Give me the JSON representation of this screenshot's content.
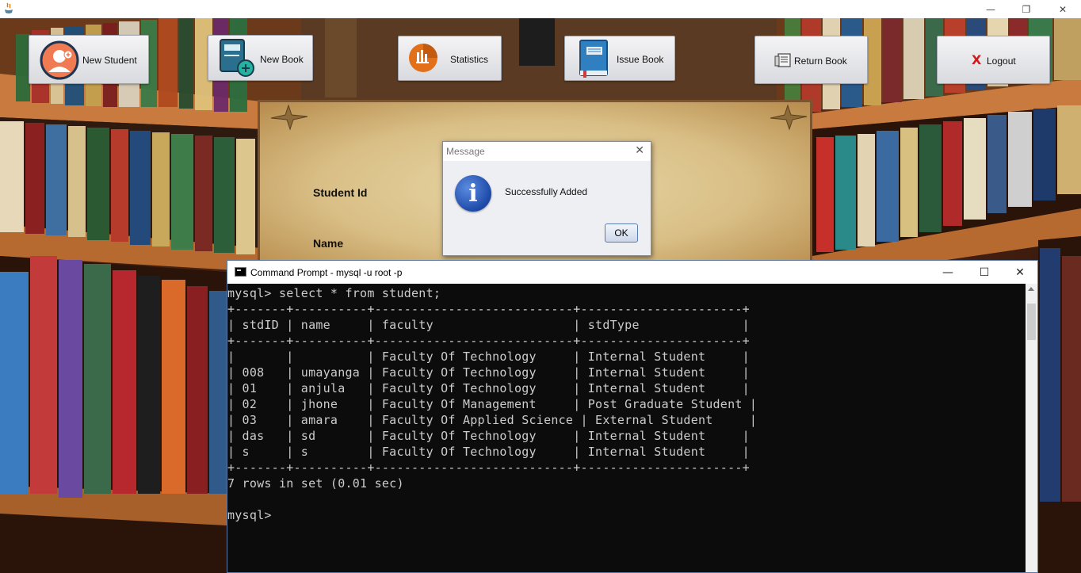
{
  "window": {
    "minimize_glyph": "—",
    "restore_glyph": "❐",
    "close_glyph": "✕"
  },
  "toolbar": {
    "new_student": "New Student",
    "new_book": "New Book",
    "statistics": "Statistics",
    "issue_book": "Issue Book",
    "return_book": "Return Book",
    "logout": "Logout",
    "logout_glyph": "X"
  },
  "form": {
    "student_id_label": "Student Id",
    "name_label": "Name"
  },
  "dialog": {
    "title": "Message",
    "close_glyph": "✕",
    "icon_glyph": "i",
    "message": "Successfully Added",
    "ok_label": "OK"
  },
  "cmd": {
    "title": "Command Prompt - mysql  -u root -p",
    "minimize_glyph": "—",
    "maximize_glyph": "☐",
    "close_glyph": "✕",
    "lines": [
      "mysql> select * from student;",
      "+-------+----------+---------------------------+----------------------+",
      "| stdID | name     | faculty                   | stdType              |",
      "+-------+----------+---------------------------+----------------------+",
      "|       |          | Faculty Of Technology     | Internal Student     |",
      "| 008   | umayanga | Faculty Of Technology     | Internal Student     |",
      "| 01    | anjula   | Faculty Of Technology     | Internal Student     |",
      "| 02    | jhone    | Faculty Of Management     | Post Graduate Student |",
      "| 03    | amara    | Faculty Of Applied Science | External Student     |",
      "| das   | sd       | Faculty Of Technology     | Internal Student     |",
      "| s     | s        | Faculty Of Technology     | Internal Student     |",
      "+-------+----------+---------------------------+----------------------+",
      "7 rows in set (0.01 sec)",
      "",
      "mysql>"
    ]
  }
}
